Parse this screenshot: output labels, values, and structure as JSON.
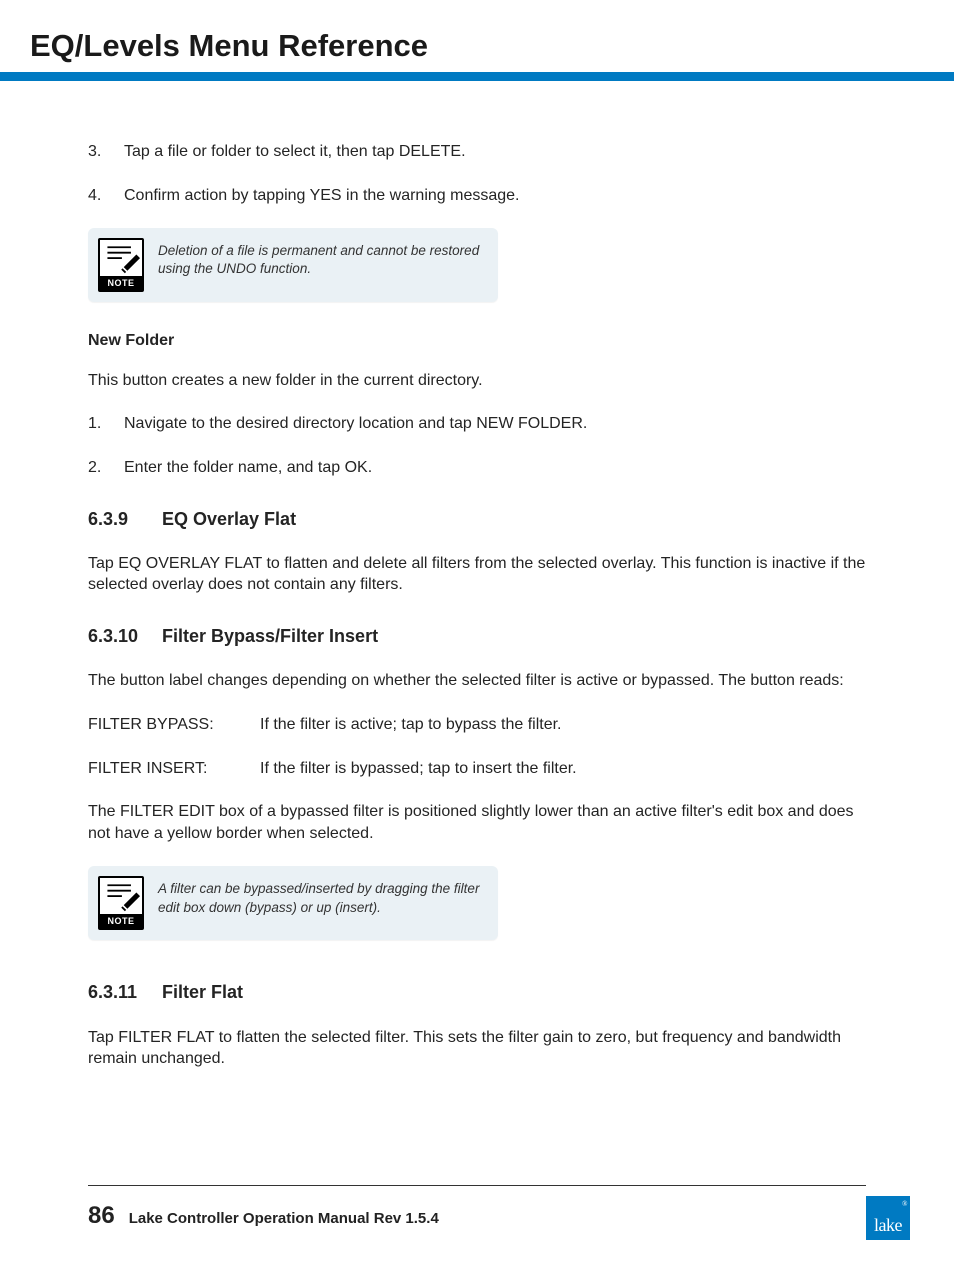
{
  "header": {
    "title": "EQ/Levels Menu Reference"
  },
  "steps_a": [
    {
      "n": "3.",
      "t": "Tap a file or folder to select it, then tap DELETE."
    },
    {
      "n": "4.",
      "t": "Confirm action by tapping YES in the warning message."
    }
  ],
  "note1": {
    "label": "NOTE",
    "text": "Deletion of a file is permanent and cannot be restored using the UNDO function."
  },
  "newfolder": {
    "heading": "New Folder",
    "intro": "This button creates a new folder in the current directory.",
    "steps": [
      {
        "n": "1.",
        "t": "Navigate to the desired directory location and tap NEW FOLDER."
      },
      {
        "n": "2.",
        "t": "Enter the folder name, and tap OK."
      }
    ]
  },
  "s639": {
    "no": "6.3.9",
    "title": "EQ Overlay Flat",
    "body": "Tap EQ OVERLAY FLAT to flatten and delete all filters from the selected overlay. This function is inactive if the selected overlay does not contain any filters."
  },
  "s6310": {
    "no": "6.3.10",
    "title": "Filter Bypass/Filter Insert",
    "intro": "The button label changes depending on whether the selected filter is active or bypassed. The button reads:",
    "defs": [
      {
        "term": "FILTER BYPASS:",
        "desc": "If the filter is active; tap to bypass the filter."
      },
      {
        "term": "FILTER INSERT:",
        "desc": "If the filter is bypassed; tap to insert the filter."
      }
    ],
    "tail": "The FILTER EDIT box of a bypassed filter is positioned slightly lower than an active filter's edit box and does not have a yellow border when selected."
  },
  "note2": {
    "label": "NOTE",
    "text": "A filter can be bypassed/inserted by dragging the filter edit box down (bypass) or up (insert)."
  },
  "s6311": {
    "no": "6.3.11",
    "title": "Filter Flat",
    "body": "Tap FILTER FLAT to flatten the selected filter. This sets the filter gain to zero, but frequency and bandwidth remain unchanged."
  },
  "footer": {
    "page": "86",
    "manual": "Lake Controller Operation Manual Rev 1.5.4",
    "logo": "lake",
    "tm": "®"
  }
}
